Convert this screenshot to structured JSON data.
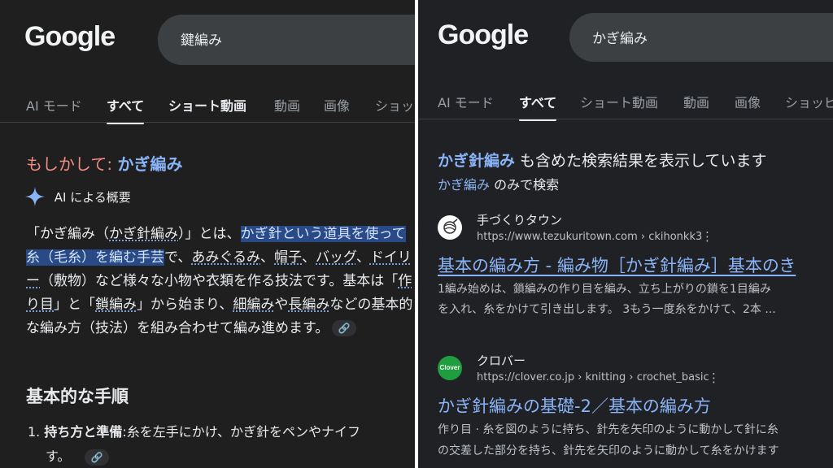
{
  "left": {
    "logo": "Google",
    "search_value": "鍵編み",
    "tabs": [
      "AI モード",
      "すべて",
      "ショート動画",
      "動画",
      "画像",
      "ショッ"
    ],
    "did_you_mean": {
      "label": "もしかして:",
      "suggestion": "かぎ編み"
    },
    "ai_overview_label": "AI による概要",
    "overview": {
      "p1": "「かぎ編み（",
      "p2": "かぎ針編み",
      "p3": "）」とは、",
      "hl": "かぎ針という道具を使って糸（毛糸）を編む手芸",
      "p4": "で、",
      "p5": "あみぐるみ",
      "p6": "、",
      "p7": "帽子",
      "p8": "、",
      "p9": "バッグ",
      "p10": "、",
      "p11": "ドイリー",
      "p12": "（敷物）など様々な小物や衣類を作る技法です。基本は「",
      "p13": "作り目",
      "p14": "」と「",
      "p15": "鎖編み",
      "p16": "」から始まり、",
      "p17": "細編み",
      "p18": "や",
      "p19": "長編み",
      "p20": "などの基本的な編み方（技法）を組み合わせて編み進めます。"
    },
    "section_heading": "基本的な手順",
    "step1_num": "1.",
    "step1_bold": "持ち方と準備",
    "step1_text": ":糸を左手にかけ、かぎ針をペンやナイフ",
    "step1_cont": "す。"
  },
  "right": {
    "logo": "Google",
    "search_value": "かぎ編み",
    "tabs": [
      "AI モード",
      "すべて",
      "ショート動画",
      "動画",
      "画像",
      "ショッピ"
    ],
    "showing": {
      "term": "かぎ針編み",
      "rest": " も含めた検索結果を表示しています"
    },
    "only": {
      "term": "かぎ編み",
      "rest": " のみで検索"
    },
    "results": [
      {
        "site": "手づくりタウン",
        "url": "https://www.tezukuritown.com › ckihonkk3",
        "title": "基本の編み方 - 編み物［かぎ針編み］基本のき",
        "snippet1": "1編み始めは、鎖編みの作り目を編み、立ち上がりの鎖を1目編み",
        "snippet2": "を入れ、糸をかけて引き出します。 3もう一度糸をかけて、2本 ..."
      },
      {
        "site": "クロバー",
        "url": "https://clover.co.jp › knitting › crochet_basic",
        "title": "かぎ針編みの基礎-2／基本の編み方",
        "snippet1": "作り目 · 糸を図のように持ち、針先を矢印のように動かして針に糸",
        "snippet2": "の交差した部分を持ち、針先を矢印のように動かして糸をかけます"
      }
    ],
    "clover_favicon_text": "Clover"
  },
  "colors": {
    "bg": "#1f1f1f",
    "link": "#8ab4f8",
    "did_you_mean": "#f28b82",
    "highlight": "#294a87"
  }
}
